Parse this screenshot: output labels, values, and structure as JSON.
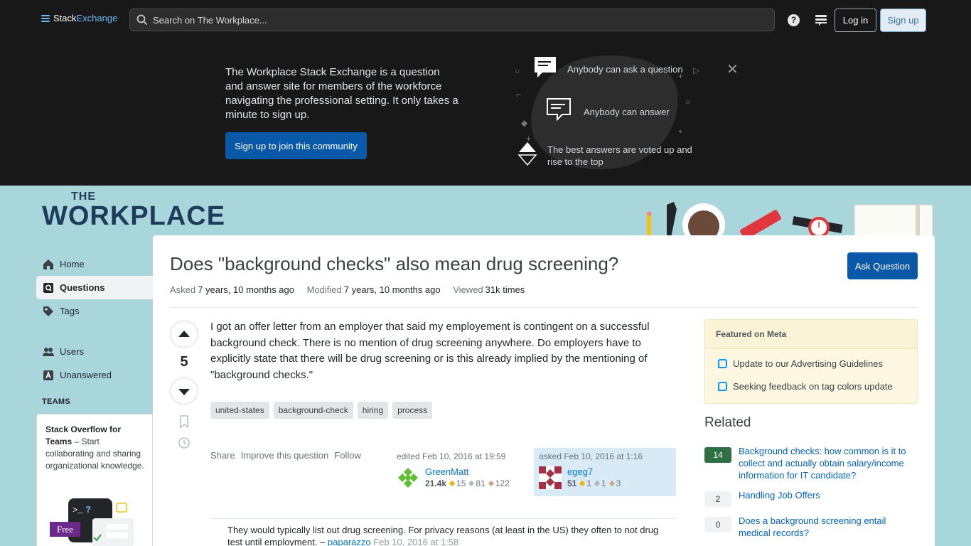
{
  "topbar": {
    "logo_part1": "Stack",
    "logo_part2": "Exchange",
    "search_placeholder": "Search on The Workplace...",
    "help_label": "?",
    "login_label": "Log in",
    "signup_label": "Sign up"
  },
  "hero": {
    "text": "The Workplace Stack Exchange is a question and answer site for members of the workforce navigating the professional setting. It only takes a minute to sign up.",
    "cta": "Sign up to join this community",
    "features": [
      "Anybody can ask a question",
      "Anybody can answer",
      "The best answers are voted up and rise to the top"
    ],
    "close": "✕"
  },
  "site": {
    "the": "THE",
    "name": "WORKPLACE"
  },
  "nav": {
    "items": [
      {
        "label": "Home",
        "icon": "home-icon"
      },
      {
        "label": "Questions",
        "icon": "questions-icon",
        "active": true
      },
      {
        "label": "Tags",
        "icon": "tag-icon"
      },
      {
        "label": "Users",
        "icon": "users-icon"
      },
      {
        "label": "Unanswered",
        "icon": "unanswered-icon"
      }
    ],
    "teams_label": "TEAMS",
    "teams_title": "Stack Overflow for Teams",
    "teams_text": " – Start collaborating and sharing organizational knowledge.",
    "teams_badge": "Free"
  },
  "question": {
    "title": "Does \"background checks\" also mean drug screening?",
    "ask_button": "Ask Question",
    "asked_label": "Asked",
    "asked_value": "7 years, 10 months ago",
    "modified_label": "Modified",
    "modified_value": "7 years, 10 months ago",
    "viewed_label": "Viewed",
    "viewed_value": "31k times",
    "votes": "5",
    "body": "I got an offer letter from an employer that said my employement is contingent on a successful background check. There is no mention of drug screening anywhere. Do employers have to explicitly state that there will be drug screening or is this already implied by the mentioning of \"background checks.\"",
    "tags": [
      "united-states",
      "background-check",
      "hiring",
      "process"
    ],
    "menu": [
      "Share",
      "Improve this question",
      "Follow"
    ],
    "editor": {
      "when": "edited Feb 10, 2016 at 19:59",
      "name": "GreenMatt",
      "rep": "21.4k",
      "gold": "15",
      "silver": "81",
      "bronze": "122"
    },
    "owner": {
      "when": "asked Feb 10, 2016 at 1:16",
      "name": "egeg7",
      "rep": "51",
      "gold": "1",
      "silver": "1",
      "bronze": "3"
    },
    "comment": {
      "text": "They would typically list out drug screening. For privacy reasons (at least in the US) they often to not drug test until employment. – ",
      "user": "paparazzo",
      "date": "Feb 10, 2016 at 1:58"
    }
  },
  "sidebar": {
    "meta_title": "Featured on Meta",
    "meta_items": [
      "Update to our Advertising Guidelines",
      "Seeking feedback on tag colors update"
    ],
    "related_title": "Related",
    "related": [
      {
        "count": "14",
        "answered": true,
        "title": "Background checks: how common is it to collect and actually obtain salary/income information for IT candidate?"
      },
      {
        "count": "2",
        "answered": false,
        "title": "Handling Job Offers"
      },
      {
        "count": "0",
        "answered": false,
        "title": "Does a background screening entail medical records?"
      }
    ]
  },
  "colors": {
    "accent": "#0a59a8",
    "site_bg": "#a9d6da",
    "answered": "#2f6f44"
  }
}
